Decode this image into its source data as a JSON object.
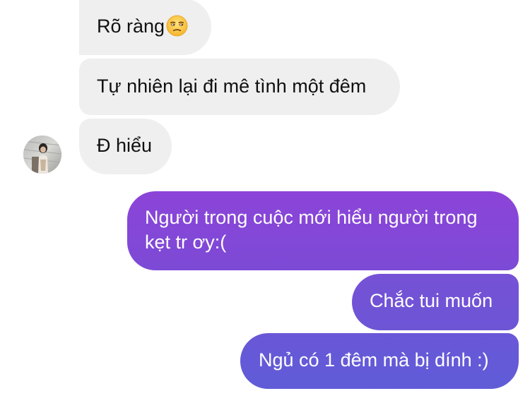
{
  "messages": {
    "received": [
      {
        "text": "Rõ ràng",
        "emoji": "unamused-face-emoji"
      },
      {
        "text": "Tự nhiên lại đi mê tình một đêm"
      },
      {
        "text": "Đ hiểu"
      }
    ],
    "sent": [
      {
        "text": "Người trong cuộc mới hiểu người trong kẹt tr ơy:("
      },
      {
        "text": "Chắc tui muốn"
      },
      {
        "text": "Ngủ có 1 đêm mà bị dính :)"
      }
    ]
  },
  "contact": {
    "avatar_icon": "profile-photo"
  },
  "colors": {
    "received_bubble": "#efefef",
    "sent_bubble_top": "#8c44d8",
    "sent_bubble_bottom": "#5f5cd8",
    "text_dark": "#111111",
    "text_light": "#ffffff"
  }
}
